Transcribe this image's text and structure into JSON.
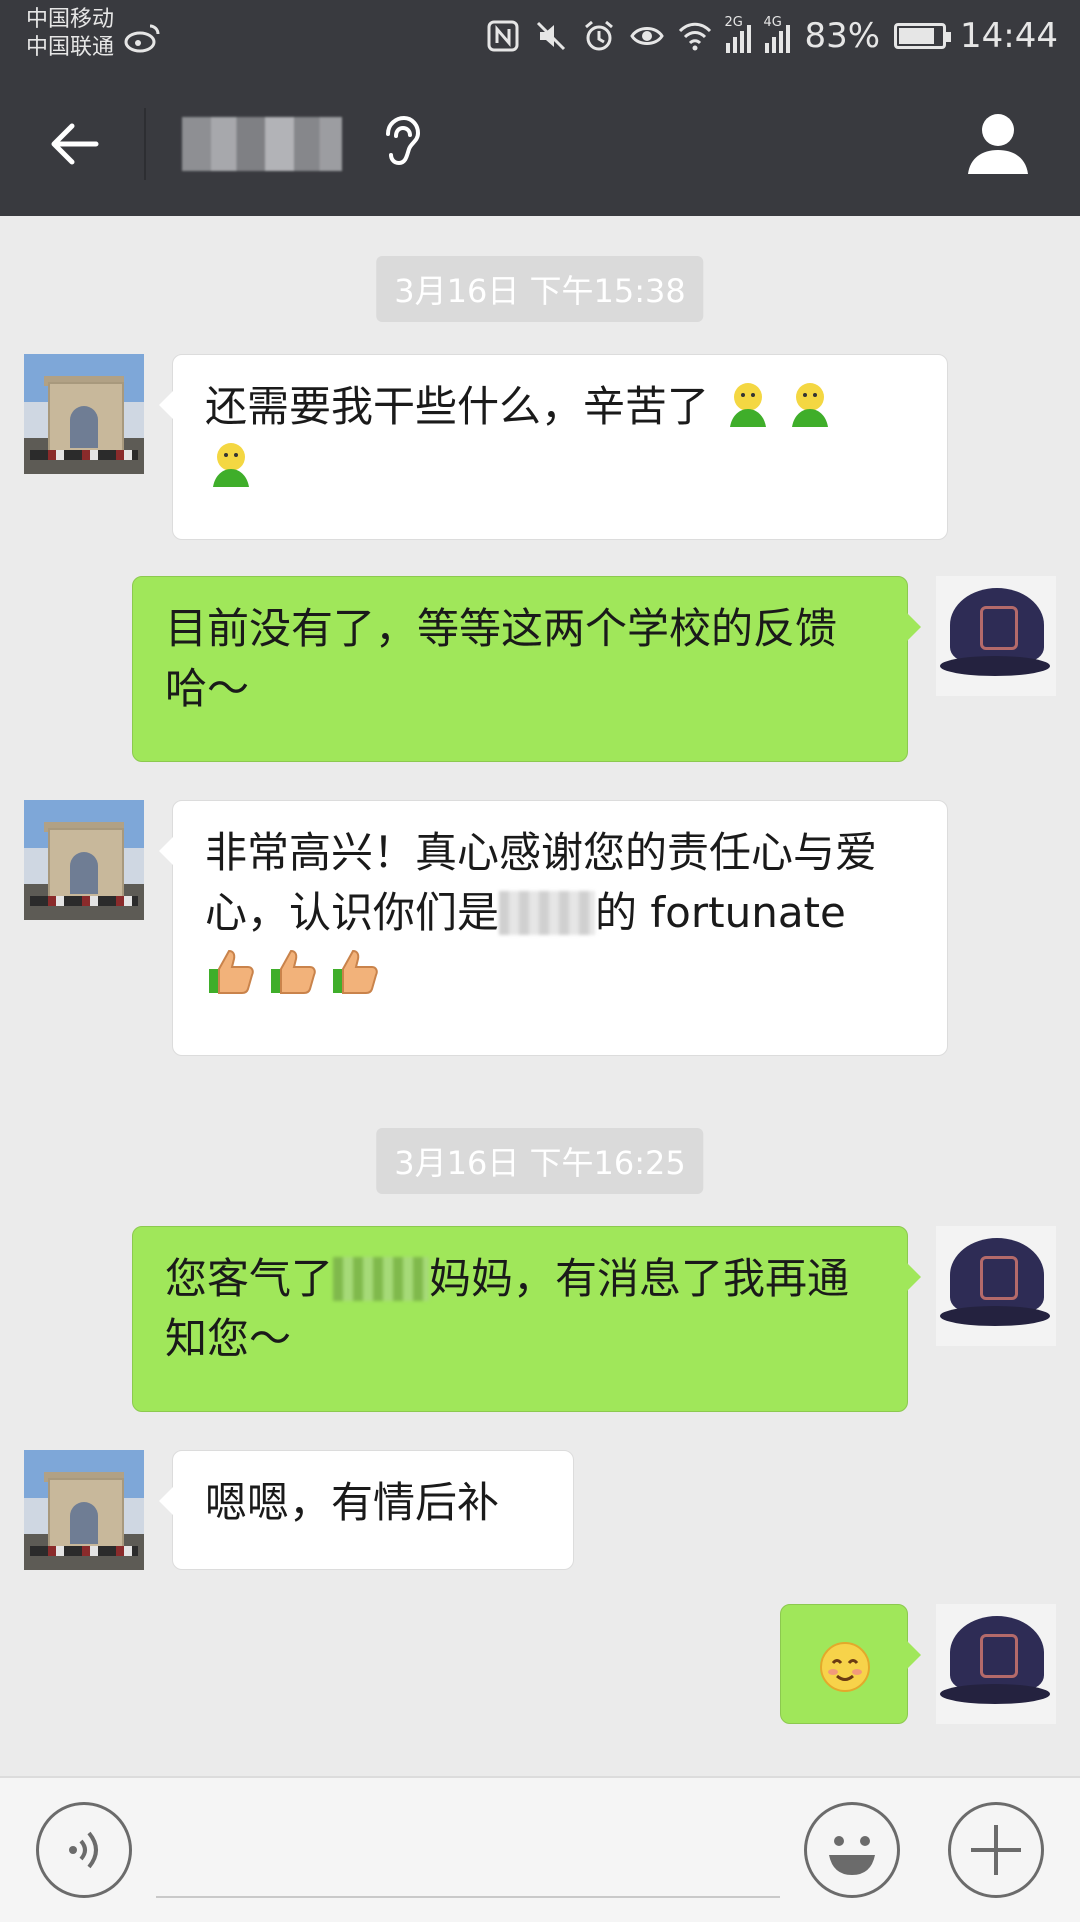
{
  "status_bar": {
    "carrier_1": "中国移动",
    "carrier_2": "中国联通",
    "signal_1_label": "2G",
    "signal_2_label": "4G",
    "battery": "83%",
    "battery_level": 0.83,
    "time": "14:44"
  },
  "header": {
    "contact_name": "",
    "back_icon": "arrow-left-icon",
    "mode_icon": "ear-icon",
    "profile_icon": "person-icon"
  },
  "messages": [
    {
      "type": "timestamp",
      "text": "3月16日 下午15:38"
    },
    {
      "type": "received",
      "text": "还需要我干些什么，辛苦了",
      "emoji": "green-smiley-icon",
      "emoji_count": 3
    },
    {
      "type": "sent",
      "text": "目前没有了，等等这两个学校的反馈哈～"
    },
    {
      "type": "received",
      "text_before": "非常高兴！真心感谢您的责任心与爱心，认识你们是",
      "text_after": "的 fortunate",
      "emoji": "thumbs-up-icon",
      "emoji_count": 3
    },
    {
      "type": "timestamp",
      "text": "3月16日 下午16:25"
    },
    {
      "type": "sent",
      "text_before": "您客气了",
      "text_after": "妈妈，有消息了我再通知您～"
    },
    {
      "type": "received",
      "text": "嗯嗯，有情后补"
    },
    {
      "type": "sent",
      "emoji": "blush-smile-icon"
    }
  ],
  "colors": {
    "header_bg": "#393a3f",
    "chat_bg": "#ebebeb",
    "sent_bubble": "#a0e75a",
    "received_bubble": "#ffffff",
    "timestamp_bg": "#dadada"
  },
  "input_bar": {
    "voice_icon": "voice-icon",
    "emoji_icon": "emoji-icon",
    "plus_icon": "plus-icon"
  }
}
